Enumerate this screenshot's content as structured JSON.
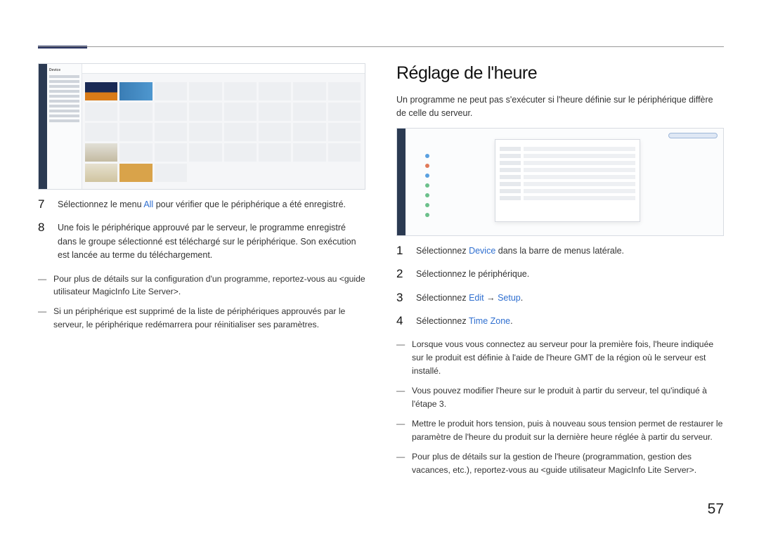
{
  "page_number": "57",
  "left": {
    "shot_label": "Device",
    "step7": {
      "prefix": "Sélectionnez le menu ",
      "link": "All",
      "suffix": " pour vérifier que le périphérique a été enregistré."
    },
    "step8": "Une fois le périphérique approuvé par le serveur, le programme enregistré dans le groupe sélectionné est téléchargé sur le périphérique. Son exécution est lancée au terme du téléchargement.",
    "notes": [
      "Pour plus de détails sur la configuration d'un programme, reportez-vous au <guide utilisateur MagicInfo Lite Server>.",
      "Si un périphérique est supprimé de la liste de périphériques approuvés par le serveur, le périphérique redémarrera pour réinitialiser ses paramètres."
    ]
  },
  "right": {
    "title": "Réglage de l'heure",
    "intro": "Un programme ne peut pas s'exécuter si l'heure définie sur le périphérique diffère de celle du serveur.",
    "step1": {
      "prefix": "Sélectionnez ",
      "link": "Device",
      "suffix": " dans la barre de menus latérale."
    },
    "step2": "Sélectionnez le périphérique.",
    "step3": {
      "prefix": "Sélectionnez ",
      "link1": "Edit",
      "arrow": " → ",
      "link2": "Setup",
      "suffix": "."
    },
    "step4": {
      "prefix": "Sélectionnez ",
      "link": "Time Zone",
      "suffix": "."
    },
    "notes": [
      "Lorsque vous vous connectez au serveur pour la première fois, l'heure indiquée sur le produit est définie à l'aide de l'heure GMT de la région où le serveur est installé.",
      "Vous pouvez modifier l'heure sur le produit à partir du serveur, tel qu'indiqué à l'étape 3.",
      "Mettre le produit hors tension, puis à nouveau sous tension permet de restaurer le paramètre de l'heure du produit sur la dernière heure réglée à partir du serveur.",
      "Pour plus de détails sur la gestion de l'heure (programmation, gestion des vacances, etc.), reportez-vous au <guide utilisateur MagicInfo Lite Server>."
    ]
  }
}
